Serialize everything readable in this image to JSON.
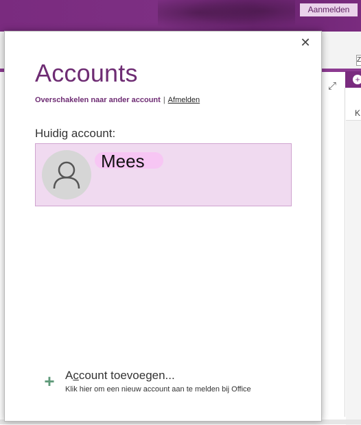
{
  "background_app": {
    "signin_label": "Aanmelden",
    "zoom_text": "Z",
    "side_plus": "+",
    "expand_glyph": "⤢",
    "right_letter": "K",
    "accent_color": "#7a2b7f"
  },
  "dialog": {
    "close_glyph": "✕",
    "title": "Accounts",
    "switch_account_label": "Overschakelen naar ander account",
    "separator": "|",
    "signout_label": "Afmelden",
    "current_account_label": "Huidig account:",
    "current_account": {
      "name": "Mees",
      "avatar_icon": "person-icon",
      "card_color": "#f0daf0"
    },
    "add_account": {
      "title_prefix": "A",
      "title_underlined": "c",
      "title_rest": "count toevoegen...",
      "description": "Klik hier om een nieuw account aan te melden bij Office",
      "icon": "plus-icon",
      "icon_color": "#5f9a7a"
    }
  }
}
